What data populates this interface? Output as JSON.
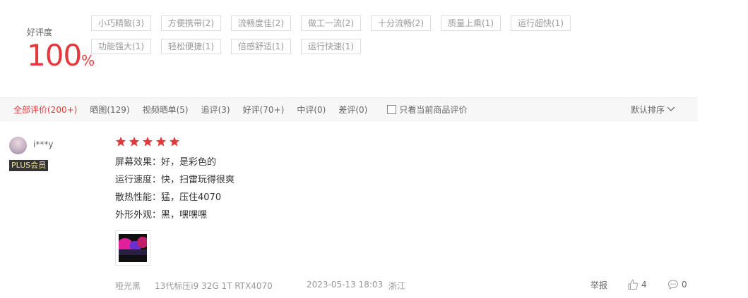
{
  "rating": {
    "label": "好评度",
    "value": "100",
    "unit": "%"
  },
  "tags": [
    "小巧精致(3)",
    "方便携带(2)",
    "流畅度佳(2)",
    "做工一流(2)",
    "十分流畅(2)",
    "质量上乘(1)",
    "运行超快(1)",
    "功能强大(1)",
    "轻松便捷(1)",
    "倍感舒适(1)",
    "运行快速(1)"
  ],
  "filters": {
    "tabs": [
      "全部评价(200+)",
      "晒图(129)",
      "视频晒单(5)",
      "追评(3)",
      "好评(70+)",
      "中评(0)",
      "差评(0)"
    ],
    "active_index": 0,
    "only_current_label": "只看当前商品评价",
    "sort_label": "默认排序"
  },
  "review": {
    "username": "i***y",
    "badge": "PLUS会员",
    "stars": 5,
    "lines": [
      "屏幕效果：好，是彩色的",
      "运行速度：快，扫雷玩得很爽",
      "散热性能：猛，压住4070",
      "外形外观：黑，嘿嘿嘿"
    ],
    "color": "哑光黑",
    "spec": "13代标压i9 32G 1T RTX4070",
    "date": "2023-05-13 18:03",
    "location": "浙江",
    "report_label": "举报",
    "likes": "4",
    "comments": "0"
  },
  "colors": {
    "accent": "#e4393c",
    "badge_bg": "#333333",
    "badge_text": "#f8e6a0"
  }
}
